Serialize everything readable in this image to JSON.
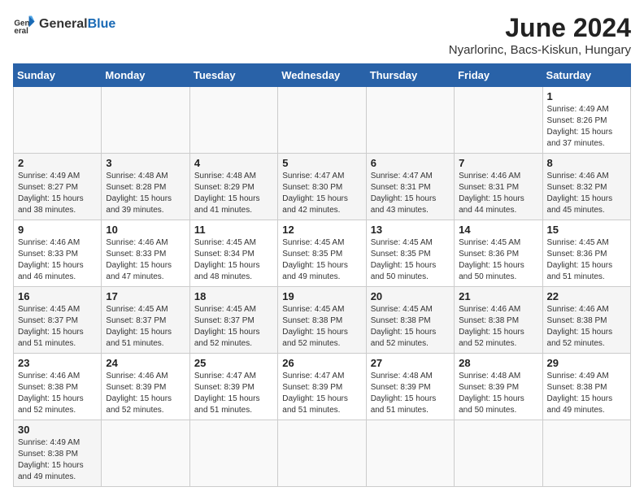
{
  "header": {
    "logo_general": "General",
    "logo_blue": "Blue",
    "month_title": "June 2024",
    "location": "Nyarlorinc, Bacs-Kiskun, Hungary"
  },
  "weekdays": [
    "Sunday",
    "Monday",
    "Tuesday",
    "Wednesday",
    "Thursday",
    "Friday",
    "Saturday"
  ],
  "weeks": [
    [
      {
        "day": "",
        "info": ""
      },
      {
        "day": "",
        "info": ""
      },
      {
        "day": "",
        "info": ""
      },
      {
        "day": "",
        "info": ""
      },
      {
        "day": "",
        "info": ""
      },
      {
        "day": "",
        "info": ""
      },
      {
        "day": "1",
        "info": "Sunrise: 4:49 AM\nSunset: 8:26 PM\nDaylight: 15 hours and 37 minutes."
      }
    ],
    [
      {
        "day": "2",
        "info": "Sunrise: 4:49 AM\nSunset: 8:27 PM\nDaylight: 15 hours and 38 minutes."
      },
      {
        "day": "3",
        "info": "Sunrise: 4:48 AM\nSunset: 8:28 PM\nDaylight: 15 hours and 39 minutes."
      },
      {
        "day": "4",
        "info": "Sunrise: 4:48 AM\nSunset: 8:29 PM\nDaylight: 15 hours and 41 minutes."
      },
      {
        "day": "5",
        "info": "Sunrise: 4:47 AM\nSunset: 8:30 PM\nDaylight: 15 hours and 42 minutes."
      },
      {
        "day": "6",
        "info": "Sunrise: 4:47 AM\nSunset: 8:31 PM\nDaylight: 15 hours and 43 minutes."
      },
      {
        "day": "7",
        "info": "Sunrise: 4:46 AM\nSunset: 8:31 PM\nDaylight: 15 hours and 44 minutes."
      },
      {
        "day": "8",
        "info": "Sunrise: 4:46 AM\nSunset: 8:32 PM\nDaylight: 15 hours and 45 minutes."
      }
    ],
    [
      {
        "day": "9",
        "info": "Sunrise: 4:46 AM\nSunset: 8:33 PM\nDaylight: 15 hours and 46 minutes."
      },
      {
        "day": "10",
        "info": "Sunrise: 4:46 AM\nSunset: 8:33 PM\nDaylight: 15 hours and 47 minutes."
      },
      {
        "day": "11",
        "info": "Sunrise: 4:45 AM\nSunset: 8:34 PM\nDaylight: 15 hours and 48 minutes."
      },
      {
        "day": "12",
        "info": "Sunrise: 4:45 AM\nSunset: 8:35 PM\nDaylight: 15 hours and 49 minutes."
      },
      {
        "day": "13",
        "info": "Sunrise: 4:45 AM\nSunset: 8:35 PM\nDaylight: 15 hours and 50 minutes."
      },
      {
        "day": "14",
        "info": "Sunrise: 4:45 AM\nSunset: 8:36 PM\nDaylight: 15 hours and 50 minutes."
      },
      {
        "day": "15",
        "info": "Sunrise: 4:45 AM\nSunset: 8:36 PM\nDaylight: 15 hours and 51 minutes."
      }
    ],
    [
      {
        "day": "16",
        "info": "Sunrise: 4:45 AM\nSunset: 8:37 PM\nDaylight: 15 hours and 51 minutes."
      },
      {
        "day": "17",
        "info": "Sunrise: 4:45 AM\nSunset: 8:37 PM\nDaylight: 15 hours and 51 minutes."
      },
      {
        "day": "18",
        "info": "Sunrise: 4:45 AM\nSunset: 8:37 PM\nDaylight: 15 hours and 52 minutes."
      },
      {
        "day": "19",
        "info": "Sunrise: 4:45 AM\nSunset: 8:38 PM\nDaylight: 15 hours and 52 minutes."
      },
      {
        "day": "20",
        "info": "Sunrise: 4:45 AM\nSunset: 8:38 PM\nDaylight: 15 hours and 52 minutes."
      },
      {
        "day": "21",
        "info": "Sunrise: 4:46 AM\nSunset: 8:38 PM\nDaylight: 15 hours and 52 minutes."
      },
      {
        "day": "22",
        "info": "Sunrise: 4:46 AM\nSunset: 8:38 PM\nDaylight: 15 hours and 52 minutes."
      }
    ],
    [
      {
        "day": "23",
        "info": "Sunrise: 4:46 AM\nSunset: 8:38 PM\nDaylight: 15 hours and 52 minutes."
      },
      {
        "day": "24",
        "info": "Sunrise: 4:46 AM\nSunset: 8:39 PM\nDaylight: 15 hours and 52 minutes."
      },
      {
        "day": "25",
        "info": "Sunrise: 4:47 AM\nSunset: 8:39 PM\nDaylight: 15 hours and 51 minutes."
      },
      {
        "day": "26",
        "info": "Sunrise: 4:47 AM\nSunset: 8:39 PM\nDaylight: 15 hours and 51 minutes."
      },
      {
        "day": "27",
        "info": "Sunrise: 4:48 AM\nSunset: 8:39 PM\nDaylight: 15 hours and 51 minutes."
      },
      {
        "day": "28",
        "info": "Sunrise: 4:48 AM\nSunset: 8:39 PM\nDaylight: 15 hours and 50 minutes."
      },
      {
        "day": "29",
        "info": "Sunrise: 4:49 AM\nSunset: 8:38 PM\nDaylight: 15 hours and 49 minutes."
      }
    ],
    [
      {
        "day": "30",
        "info": "Sunrise: 4:49 AM\nSunset: 8:38 PM\nDaylight: 15 hours and 49 minutes."
      },
      {
        "day": "",
        "info": ""
      },
      {
        "day": "",
        "info": ""
      },
      {
        "day": "",
        "info": ""
      },
      {
        "day": "",
        "info": ""
      },
      {
        "day": "",
        "info": ""
      },
      {
        "day": "",
        "info": ""
      }
    ]
  ]
}
